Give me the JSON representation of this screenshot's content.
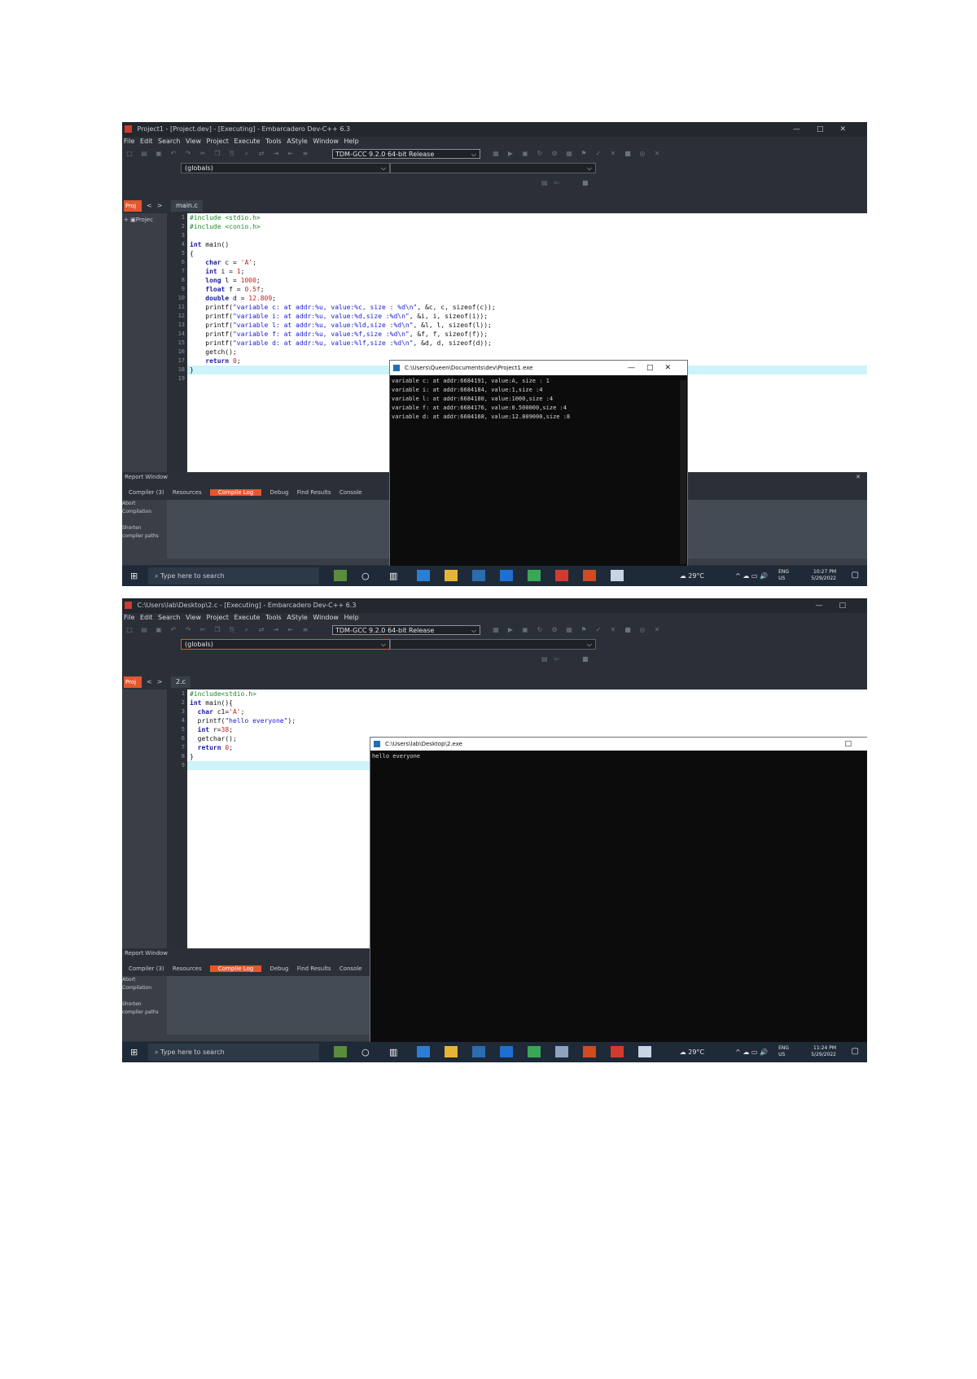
{
  "screenshot1": {
    "window_title": "Project1 - [Project.dev] - [Executing] - Embarcadero Dev-C++ 6.3",
    "menu": [
      "File",
      "Edit",
      "Search",
      "View",
      "Project",
      "Execute",
      "Tools",
      "AStyle",
      "Window",
      "Help"
    ],
    "compiler": "TDM-GCC 9.2.0 64-bit Release",
    "scope": "(globals)",
    "project_tab": "Proj",
    "file_tab": "main.c",
    "project_tree_item": "Projec",
    "code_lines": [
      {
        "n": "1",
        "text": "#include <stdio.h>"
      },
      {
        "n": "2",
        "text": "#include <conio.h>"
      },
      {
        "n": "3",
        "text": ""
      },
      {
        "n": "4",
        "text": "int main()"
      },
      {
        "n": "5",
        "text": "{"
      },
      {
        "n": "6",
        "text": "    char c = 'A';"
      },
      {
        "n": "7",
        "text": "    int i = 1;"
      },
      {
        "n": "8",
        "text": "    long l = 1000;"
      },
      {
        "n": "9",
        "text": "    float f = 0.5f;"
      },
      {
        "n": "10",
        "text": "    double d = 12.809;"
      },
      {
        "n": "11",
        "text": "    printf(\"variable c: at addr:%u, value:%c, size : %d\\n\", &c, c, sizeof(c));"
      },
      {
        "n": "12",
        "text": "    printf(\"variable i: at addr:%u, value:%d,size :%d\\n\", &i, i, sizeof(i));"
      },
      {
        "n": "13",
        "text": "    printf(\"variable l: at addr:%u, value:%ld,size :%d\\n\", &l, l, sizeof(l));"
      },
      {
        "n": "14",
        "text": "    printf(\"variable f: at addr:%u, value:%f,size :%d\\n\", &f, f, sizeof(f));"
      },
      {
        "n": "15",
        "text": "    printf(\"variable d: at addr:%u, value:%lf,size :%d\\n\", &d, d, sizeof(d));"
      },
      {
        "n": "16",
        "text": "    getch();"
      },
      {
        "n": "17",
        "text": "    return 0;"
      },
      {
        "n": "18",
        "text": "}"
      },
      {
        "n": "19",
        "text": ""
      }
    ],
    "console_title": "C:\\Users\\Queen\\Documents\\dev\\Project1.exe",
    "console_lines": [
      "variable c: at addr:6684191, value:A, size : 1",
      "variable i: at addr:6684184, value:1,size :4",
      "variable l: at addr:6684180, value:1000,size :4",
      "variable f: at addr:6684176, value:0.500000,size :4",
      "variable d: at addr:6684168, value:12.809000,size :8"
    ],
    "report_title": "Report Window",
    "report_tabs": [
      "Compiler (3)",
      "Resources",
      "Compile Log",
      "Debug",
      "Find Results",
      "Console"
    ],
    "report_side": [
      "Abort Compilation",
      "Shorten compiler paths"
    ],
    "taskbar": {
      "search_placeholder": "Type here to search",
      "weather": "29°C",
      "lang": "ENG",
      "lang2": "US",
      "time": "10:27 PM",
      "date": "5/29/2022"
    }
  },
  "screenshot2": {
    "window_title": "C:\\Users\\lab\\Desktop\\2.c - [Executing] - Embarcadero Dev-C++ 6.3",
    "menu": [
      "File",
      "Edit",
      "Search",
      "View",
      "Project",
      "Execute",
      "Tools",
      "AStyle",
      "Window",
      "Help"
    ],
    "compiler": "TDM-GCC 9.2.0 64-bit Release",
    "scope": "(globals)",
    "project_tab": "Proj",
    "file_tab": "2.c",
    "code_lines": [
      {
        "n": "1",
        "text": "#include<stdio.h>"
      },
      {
        "n": "2",
        "text": "int main(){"
      },
      {
        "n": "3",
        "text": "  char c1='A';"
      },
      {
        "n": "4",
        "text": "  printf(\"hello everyone\");"
      },
      {
        "n": "5",
        "text": "  int r=38;"
      },
      {
        "n": "6",
        "text": "  getchar();"
      },
      {
        "n": "7",
        "text": "  return 0;"
      },
      {
        "n": "8",
        "text": "}"
      },
      {
        "n": "9",
        "text": ""
      }
    ],
    "console_title": "C:\\Users\\lab\\Desktop\\2.exe",
    "console_lines": [
      "hello everyone"
    ],
    "report_title": "Report Window",
    "report_tabs": [
      "Compiler (3)",
      "Resources",
      "Compile Log",
      "Debug",
      "Find Results",
      "Console"
    ],
    "report_side": [
      "Abort Compilation",
      "Shorten compiler paths"
    ],
    "taskbar": {
      "search_placeholder": "Type here to search",
      "weather": "29°C",
      "lang": "ENG",
      "lang2": "US",
      "time": "11:24 PM",
      "date": "5/29/2022"
    }
  },
  "colors": {
    "accent": "#e4572e",
    "editor_bg": "#ffffff",
    "console_bg": "#0c0c0c",
    "ide_bg": "#2b3038",
    "taskbar_bg": "#1f2a38"
  }
}
